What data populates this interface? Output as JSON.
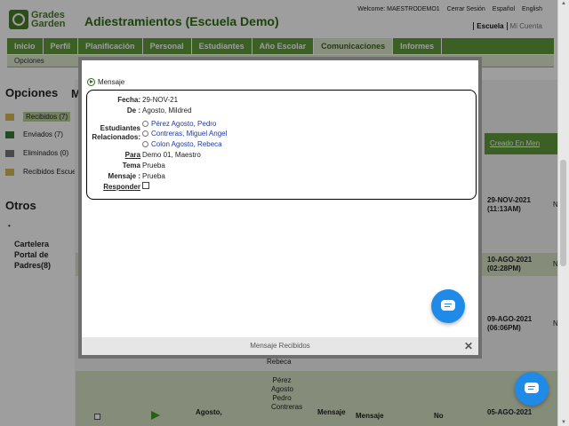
{
  "header": {
    "logo_line1": "Grades",
    "logo_line2": "Garden",
    "title": "Adiestramientos (Escuela Demo)",
    "welcome": "Welcome: MAESTRODEMO1",
    "logout": "Cerrar Sesión",
    "lang_es": "Español",
    "lang_en": "English",
    "link_escuela": "Escuela",
    "link_mi_cuenta": "Mi Cuenta"
  },
  "nav": {
    "items": [
      "Inicio",
      "Perfil",
      "Planificación",
      "Personal",
      "Estudiantes",
      "Año Escolar",
      "Comunicaciones",
      "Informes"
    ],
    "active": "Comunicaciones",
    "sub": "Opciones"
  },
  "sidebar": {
    "title": "Opciones",
    "items": [
      {
        "label": "Recibidos (7)",
        "icon": "folder-icon"
      },
      {
        "label": "Enviados (7)",
        "icon": "sent-icon"
      },
      {
        "label": "Eliminados (0)",
        "icon": "trash-icon"
      },
      {
        "label": "Recibidos Escue",
        "icon": "folder-icon"
      }
    ],
    "otros_title": "Otros",
    "bullet": "•",
    "cartelera": "Cartelera Portal de Padres(8)"
  },
  "background": {
    "msgs_head": "M",
    "column_header": "Creado En Men",
    "dates": [
      {
        "date": "29-NOV-2021",
        "time": "(11:13AM)"
      },
      {
        "date": "10-AGO-2021",
        "time": "(02:28PM)"
      },
      {
        "date": "09-AGO-2021",
        "time": "(06:06PM)"
      },
      {
        "date": "05-AGO-2021",
        "time": ""
      }
    ],
    "partial_names": [
      "Pérez",
      "Agosto",
      "Pedro",
      "Contreras"
    ],
    "partial_from": "Agosto,",
    "partial_mensaje": "Mensaje",
    "partial_mensaje2": "Mensaje",
    "partial_no": "No",
    "partial_rechaza": "Rebeca",
    "col_letter": "N"
  },
  "modal": {
    "heading": "Mensaje",
    "fecha_label": "Fecha:",
    "fecha": "29-NOV-21",
    "de_label": "De :",
    "de": "Agosto, Mildred",
    "estudiantes_label": "Estudiantes Relacionados:",
    "students": [
      "Pérez Agosto, Pedro",
      "Contreras, Miguel Angel",
      "Colon Agosto, Rebeca"
    ],
    "para_label": "Para",
    "para": "Demo 01, Maestro",
    "tema_label": "Tema",
    "tema": "Prueba",
    "mensaje_label": "Mensaje :",
    "mensaje": "Prueba",
    "responder_label": "Responder",
    "footer": "Mensaje Recibidos",
    "close": "✕"
  }
}
